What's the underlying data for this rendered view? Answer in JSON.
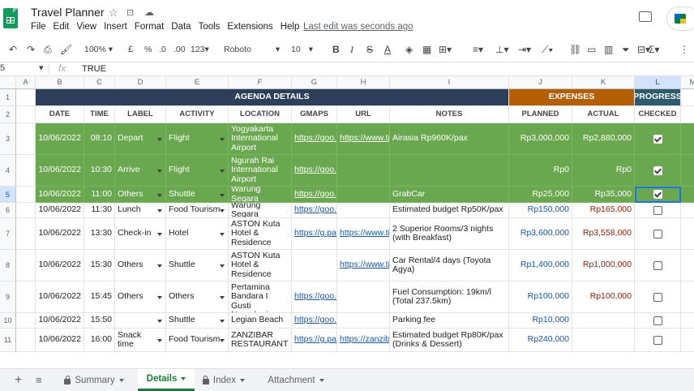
{
  "app": {
    "title": "Travel Planner",
    "last_edit": "Last edit was seconds ago",
    "menu": [
      "File",
      "Edit",
      "View",
      "Insert",
      "Format",
      "Data",
      "Tools",
      "Extensions",
      "Help"
    ]
  },
  "toolbar": {
    "zoom": "100%",
    "currency": "£",
    "percent": "%",
    "dec_less": ".0",
    "dec_more": ".00",
    "more_formats": "123",
    "font": "Roboto",
    "font_size": "10",
    "bold": "B",
    "italic": "I",
    "strike": "S",
    "text_color": "A"
  },
  "formula_bar": {
    "name_box": "5",
    "fx": "fx",
    "value": "TRUE"
  },
  "columns": [
    "A",
    "B",
    "C",
    "D",
    "E",
    "F",
    "G",
    "H",
    "I",
    "J",
    "K",
    "L",
    "M"
  ],
  "row_numbers": [
    "1",
    "2",
    "3",
    "4",
    "5",
    "6",
    "7",
    "8",
    "9",
    "10",
    "11"
  ],
  "headers": {
    "agenda": "AGENDA DETAILS",
    "expenses": "EXPENSES",
    "progress": "PROGRESS",
    "date": "DATE",
    "time": "TIME",
    "label": "LABEL",
    "activity": "ACTIVITY",
    "location": "LOCATION",
    "gmaps": "GMAPS",
    "url": "URL",
    "notes": "NOTES",
    "planned": "PLANNED",
    "actual": "ACTUAL",
    "checked": "CHECKED"
  },
  "rows": [
    {
      "date": "10/06/2022",
      "time": "08:10",
      "label": "Depart",
      "activity": "Flight",
      "location": "Yogyakarta International Airport",
      "gmaps": "https://goo.gl",
      "url": "https://www.tiket.com",
      "notes": "Airasia Rp960K/pax",
      "planned": "Rp3,000,000",
      "actual": "Rp2,880,000",
      "checked": "true"
    },
    {
      "date": "10/06/2022",
      "time": "10:30",
      "label": "Arrive",
      "activity": "Flight",
      "location": "Ngurah Rai International Airport",
      "gmaps": "https://goo.gl",
      "url": "",
      "notes": "",
      "planned": "Rp0",
      "actual": "Rp0",
      "checked": "true"
    },
    {
      "date": "10/06/2022",
      "time": "11:00",
      "label": "Others",
      "activity": "Shuttle",
      "location": "Warung Segara",
      "gmaps": "https://goo.gl",
      "url": "",
      "notes": "GrabCar",
      "planned": "Rp25,000",
      "actual": "Rp35,000",
      "checked": "true"
    },
    {
      "date": "10/06/2022",
      "time": "11:30",
      "label": "Lunch",
      "activity": "Food Tourism",
      "location": "Warung Segara",
      "gmaps": "https://goo.gl",
      "url": "",
      "notes": "Estimated budget Rp50K/pax",
      "planned": "Rp150,000",
      "actual": "Rp165,000",
      "checked": "false"
    },
    {
      "date": "10/06/2022",
      "time": "13:30",
      "label": "Check-in",
      "activity": "Hotel",
      "location": "ASTON Kuta Hotel & Residence",
      "gmaps": "https://g.page",
      "url": "https://www.tiket.com",
      "notes": "2 Superior Rooms/3 nights (with Breakfast)",
      "planned": "Rp3,600,000",
      "actual": "Rp3,558,000",
      "checked": "false"
    },
    {
      "date": "10/06/2022",
      "time": "15:30",
      "label": "Others",
      "activity": "Shuttle",
      "location": "ASTON Kuta Hotel & Residence",
      "gmaps": "",
      "url": "https://www.tiket.com",
      "notes": "Car Rental/4 days (Toyota Agya)",
      "planned": "Rp1,400,000",
      "actual": "Rp1,000,000",
      "checked": "false"
    },
    {
      "date": "10/06/2022",
      "time": "15:45",
      "label": "Others",
      "activity": "Others",
      "location": "SPBU Pertamina Bandara I Gusti Ngurahrai",
      "gmaps": "https://goo.gl",
      "url": "",
      "notes": "Fuel Consumption: 19km/l (Total 237.5km)",
      "planned": "Rp100,000",
      "actual": "Rp100,000",
      "checked": "false"
    },
    {
      "date": "10/06/2022",
      "time": "15:50",
      "label": "",
      "activity": "Shuttle",
      "location": "Legian Beach",
      "gmaps": "https://goo.gl",
      "url": "",
      "notes": "Parking fee",
      "planned": "Rp10,000",
      "actual": "",
      "checked": "false"
    },
    {
      "date": "10/06/2022",
      "time": "16:00",
      "label": "Snack time",
      "activity": "Food Tourism",
      "location": "ZANZIBAR RESTAURANT",
      "gmaps": "https://g.page",
      "url": "https://zanzibar.com",
      "notes": "Estimated budget Rp80K/pax (Drinks & Dessert)",
      "planned": "Rp240,000",
      "actual": "",
      "checked": "false"
    }
  ],
  "sheet_tabs": [
    {
      "label": "Summary",
      "locked": true,
      "active": false
    },
    {
      "label": "Details",
      "locked": false,
      "active": true
    },
    {
      "label": "Index",
      "locked": true,
      "active": false
    },
    {
      "label": "Attachment",
      "locked": false,
      "active": false
    }
  ],
  "colors": {
    "green_row": "#6aa84f",
    "agenda_header": "#2c3e5a",
    "expenses_header": "#b45f06",
    "progress_header": "#2c5b6e",
    "active_tab": "#188038"
  }
}
